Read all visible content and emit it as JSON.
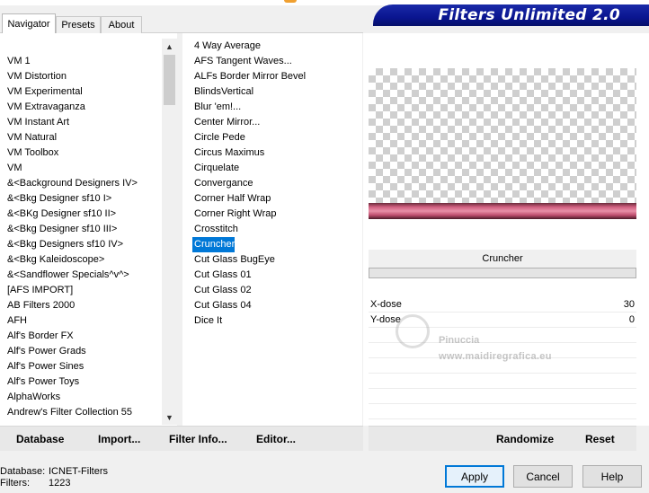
{
  "header": {
    "banner_title": "Filters Unlimited 2.0"
  },
  "tabs": [
    {
      "label": "Navigator",
      "active": true
    },
    {
      "label": "Presets",
      "active": false
    },
    {
      "label": "About",
      "active": false
    }
  ],
  "categories": [
    "VM 1",
    "VM Distortion",
    "VM Experimental",
    "VM Extravaganza",
    "VM Instant Art",
    "VM Natural",
    "VM Toolbox",
    "VM",
    "&<Background Designers IV>",
    "&<Bkg Designer sf10 I>",
    "&<BKg Designer sf10 II>",
    "&<Bkg Designer sf10 III>",
    "&<Bkg Designers sf10 IV>",
    "&<Bkg Kaleidoscope>",
    "&<Sandflower Specials^v^>",
    "[AFS IMPORT]",
    "AB Filters 2000",
    "AFH",
    "Alf's Border FX",
    "Alf's Power Grads",
    "Alf's Power Sines",
    "Alf's Power Toys",
    "AlphaWorks",
    "Andrew's Filter Collection 55"
  ],
  "filters": [
    "4 Way Average",
    "AFS Tangent Waves...",
    "ALFs Border Mirror Bevel",
    "BlindsVertical",
    "Blur 'em!...",
    "Center Mirror...",
    "Circle Pede",
    "Circus Maximus",
    "Cirquelate",
    "Convergance",
    "Corner Half Wrap",
    "Corner Right Wrap",
    "Crosstitch",
    "Cruncher",
    "Cut Glass  BugEye",
    "Cut Glass 01",
    "Cut Glass 02",
    "Cut Glass 04",
    "Dice It"
  ],
  "selected_filter": "Cruncher",
  "params": [
    {
      "label": "X-dose",
      "value": "30"
    },
    {
      "label": "Y-dose",
      "value": "0"
    }
  ],
  "watermark": {
    "line1": "Pinuccia",
    "line2": "www.maidiregrafica.eu"
  },
  "toolbar": {
    "database": "Database",
    "import": "Import...",
    "filter_info": "Filter Info...",
    "editor": "Editor...",
    "randomize": "Randomize",
    "reset": "Reset"
  },
  "footer": {
    "database_label": "Database:",
    "database_value": "ICNET-Filters",
    "filters_label": "Filters:",
    "filters_value": "1223"
  },
  "buttons": {
    "apply": "Apply",
    "cancel": "Cancel",
    "help": "Help"
  },
  "scroll_arrows": {
    "up": "▲",
    "down": "▼"
  }
}
